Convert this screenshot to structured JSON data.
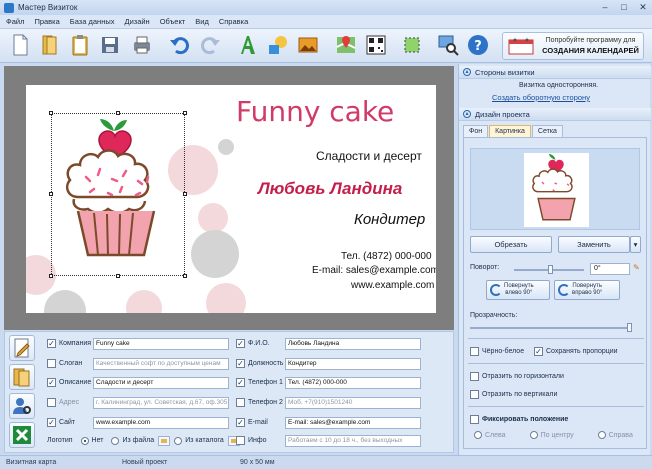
{
  "window": {
    "title": "Мастер Визиток",
    "min": "–",
    "max": "□",
    "close": "✕"
  },
  "menu": [
    "Файл",
    "Правка",
    "База данных",
    "Дизайн",
    "Объект",
    "Вид",
    "Справка"
  ],
  "toolbar": {
    "icons": [
      "new-document-icon",
      "open-folder-icon",
      "clipboard-icon",
      "save-icon",
      "print-icon",
      "undo-icon",
      "redo-icon",
      "text-icon",
      "shapes-icon",
      "image-icon",
      "map-icon",
      "qr-code-icon",
      "crop-icon",
      "zoom-icon",
      "help-icon"
    ],
    "calendar_line1": "Попробуйте программу для",
    "calendar_line2": "СОЗДАНИЯ КАЛЕНДАРЕЙ"
  },
  "card": {
    "company": "Funny cake",
    "slogan": "Сладости и десерт",
    "name": "Любовь Ландина",
    "position": "Кондитер",
    "phone": "Тел. (4872) 000-000",
    "email": "E-mail: sales@example.com",
    "site": "www.example.com"
  },
  "fields": {
    "left": [
      {
        "label": "Компания",
        "value": "Funny cake",
        "checked": true,
        "dim": false
      },
      {
        "label": "Слоган",
        "value": "Качественный софт по доступным ценам",
        "checked": false,
        "dim": true
      },
      {
        "label": "Описание",
        "value": "Сладости и десерт",
        "checked": true,
        "dim": false
      },
      {
        "label": "Адрес",
        "value": "г. Калининград, ул. Советская, д.67, оф.305",
        "checked": false,
        "dim": true
      },
      {
        "label": "Сайт",
        "value": "www.example.com",
        "checked": true,
        "dim": false
      }
    ],
    "right": [
      {
        "label": "Ф.И.О.",
        "value": "Любовь Ландина",
        "checked": true,
        "dim": false
      },
      {
        "label": "Должность",
        "value": "Кондитер",
        "checked": true,
        "dim": false
      },
      {
        "label": "Телефон 1",
        "value": "Тел. (4872) 000-000",
        "checked": true,
        "dim": false
      },
      {
        "label": "Телефон 2",
        "value": "Моб. +7(910)1501240",
        "checked": false,
        "dim": true
      },
      {
        "label": "E-mail",
        "value": "E-mail: sales@example.com",
        "checked": true,
        "dim": false
      },
      {
        "label": "Инфо",
        "value": "Работаем с 10 до 18 ч., без выходных",
        "checked": false,
        "dim": true
      }
    ],
    "logo_label": "Логотип",
    "logo_options": [
      "Нет",
      "Из файла",
      "Из каталога"
    ],
    "logo_selected": "Нет",
    "side_icons": [
      "edit-card-icon",
      "templates-icon",
      "database-icon",
      "excel-icon"
    ]
  },
  "panel": {
    "sides_header": "Стороны визитки",
    "sides_text": "Визитка односторонняя.",
    "sides_link": "Создать оборотную сторону",
    "design_header": "Дизайн проекта",
    "tabs": [
      "Фон",
      "Картинка",
      "Сетка"
    ],
    "active_tab": "Картинка",
    "crop_btn": "Обрезать",
    "replace_btn": "Заменить",
    "dropdown_arrow": "▾",
    "rotation_label": "Поворот:",
    "rotation_value": "0°",
    "rotate_left": [
      "Повернуть",
      "влево 90°"
    ],
    "rotate_right": [
      "Повернуть",
      "вправо 90°"
    ],
    "transparency_label": "Прозрачность:",
    "transparency_value": 1.0,
    "bw_label": "Чёрно-белое",
    "bw_checked": false,
    "keep_ratio_label": "Сохранять пропорции",
    "keep_ratio_checked": true,
    "flip_h_label": "Отразить по горизонтали",
    "flip_v_label": "Отразить по вертикали",
    "fix_pos_label": "Фиксировать положение",
    "fix_options": [
      "Слева",
      "По центру",
      "Справа"
    ]
  },
  "status": {
    "type": "Визитная карта",
    "project": "Новый проект",
    "size": "90 x 50 мм"
  },
  "colors": {
    "accent": "#d03b68",
    "name": "#c41e4a",
    "dot_pink": "#f3d8dc",
    "dot_gray": "#d4d4d4",
    "panel": "#dbe7f6"
  }
}
